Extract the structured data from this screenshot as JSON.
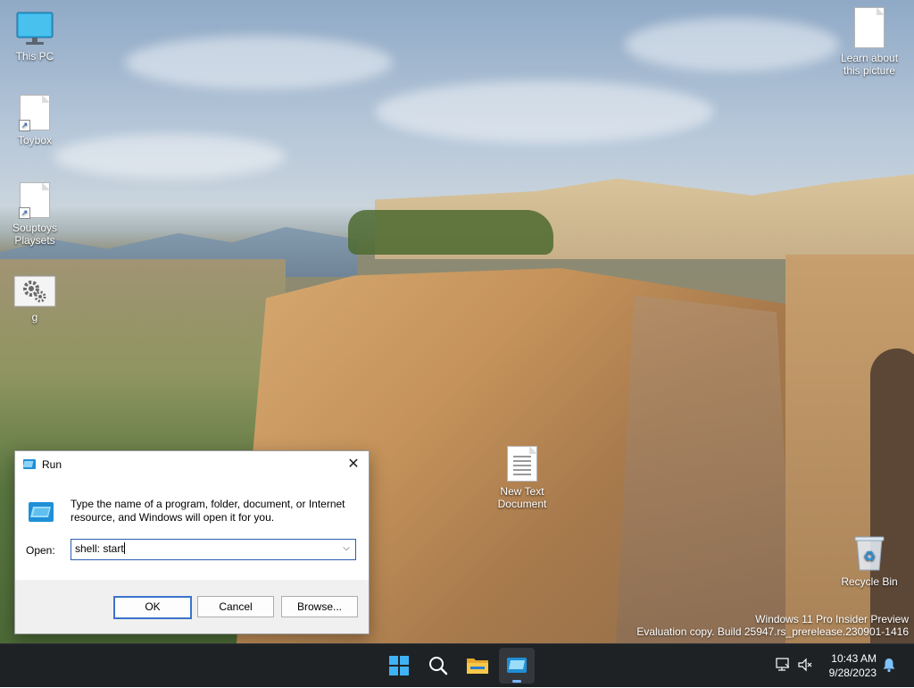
{
  "desktop": {
    "icons": {
      "this_pc": "This PC",
      "toybox": "Toybox",
      "souptoys": "Souptoys Playsets",
      "g": "g",
      "learn": "Learn about this picture",
      "new_text": "New Text Document",
      "recycle": "Recycle Bin"
    },
    "watermark": {
      "line1": "Windows 11 Pro Insider Preview",
      "line2": "Evaluation copy. Build 25947.rs_prerelease.230901-1416"
    }
  },
  "run_dialog": {
    "title": "Run",
    "description": "Type the name of a program, folder, document, or Internet resource, and Windows will open it for you.",
    "open_label": "Open:",
    "open_value": "shell: start",
    "ok_label": "OK",
    "cancel_label": "Cancel",
    "browse_label": "Browse...",
    "close_glyph": "✕",
    "dropdown_glyph": "⌵"
  },
  "taskbar": {
    "time": "10:43 AM",
    "date": "9/28/2023",
    "pinned": [
      "start-icon",
      "search-icon",
      "file-explorer-icon",
      "run-icon"
    ]
  },
  "colors": {
    "accent": "#3b73c9",
    "taskbar": "#1f2225",
    "active_indicator": "#7cb7ff"
  }
}
